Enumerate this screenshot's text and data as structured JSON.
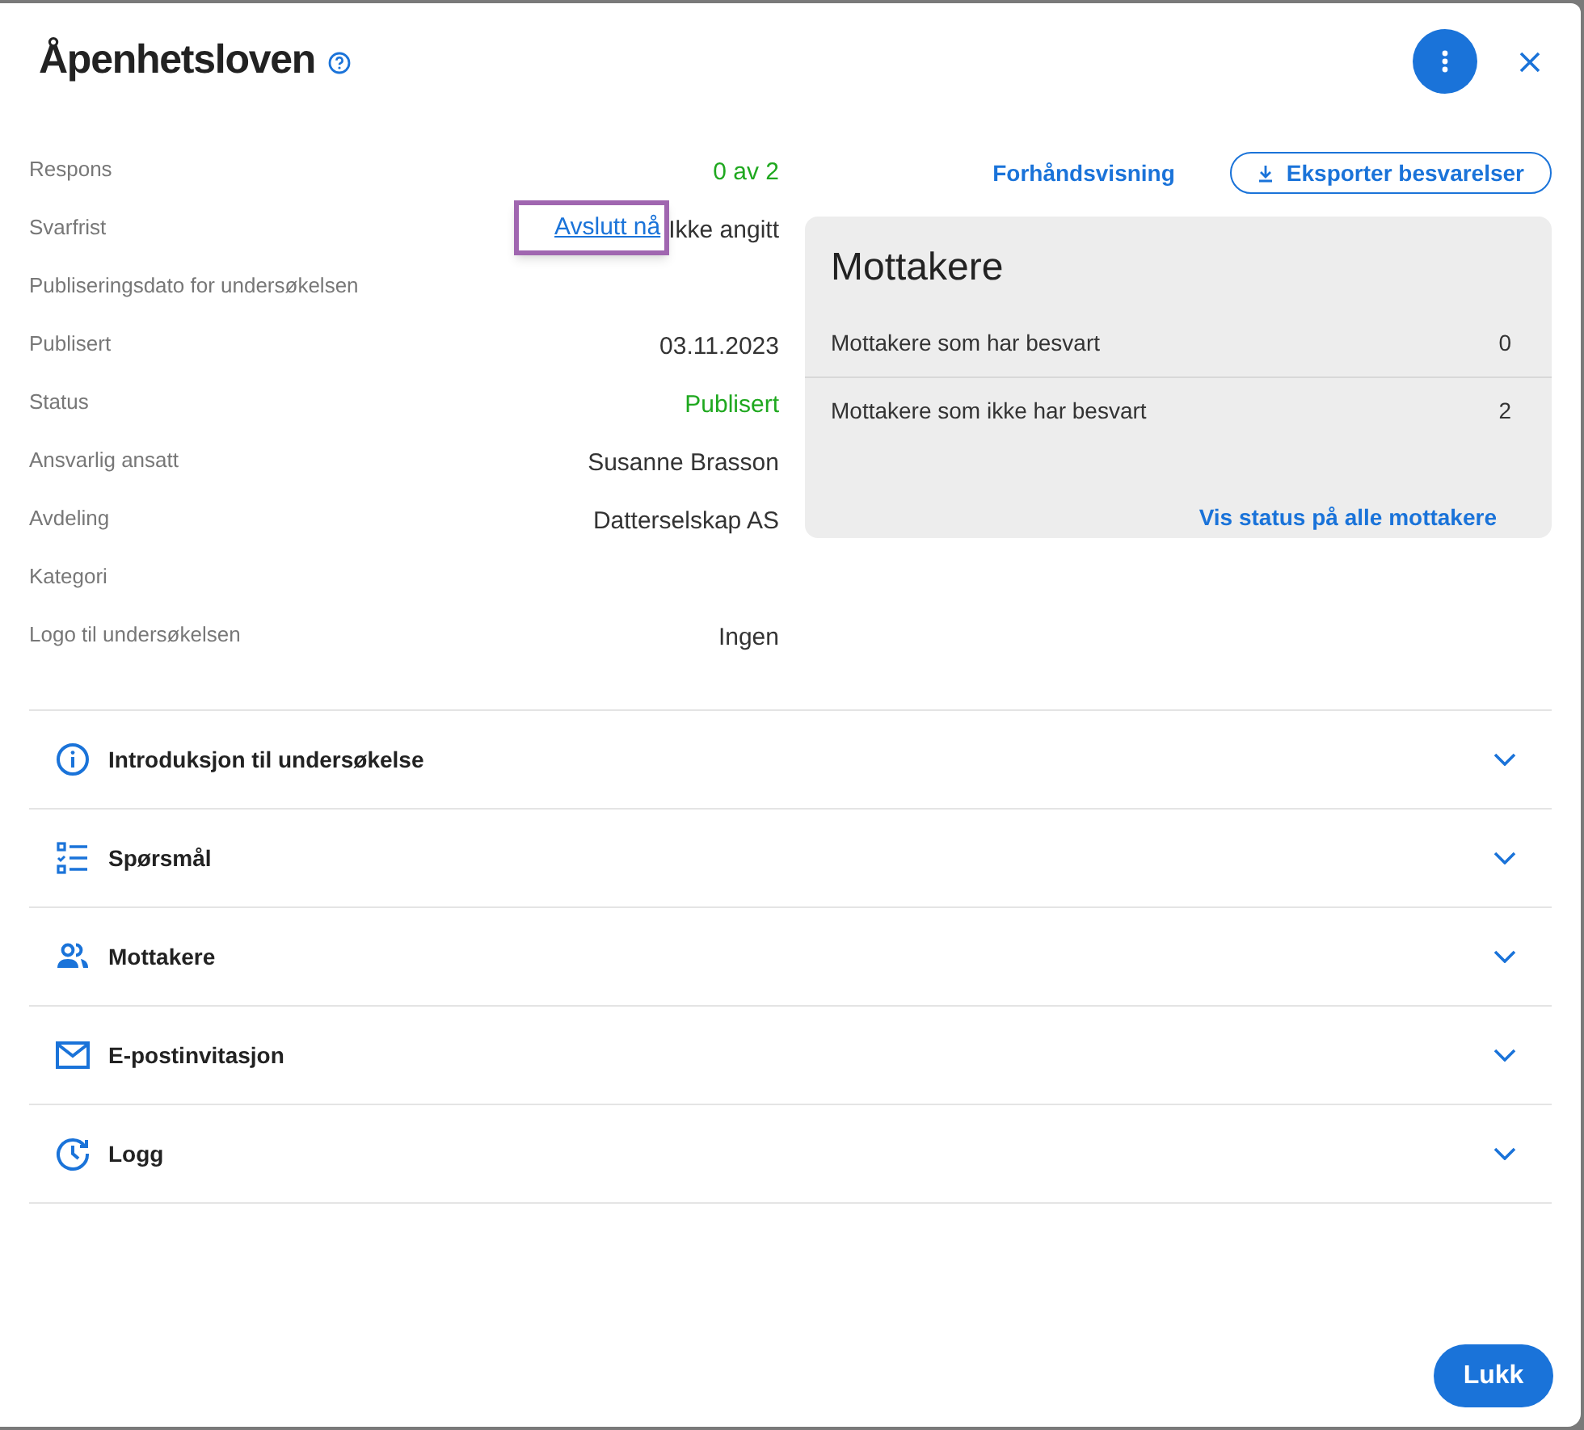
{
  "dialog": {
    "title": "Åpenhetsloven",
    "close_label": "Lukk"
  },
  "details": [
    {
      "label": "Respons",
      "value": "0 av 2",
      "color": "#1fa81f"
    },
    {
      "label": "Svarfrist",
      "value": "Ikke angitt",
      "color": "#333333",
      "link": "Avslutt nå",
      "highlighted": true
    },
    {
      "label": "Publiseringsdato for undersøkelsen"
    },
    {
      "label": "Publisert",
      "value": "03.11.2023",
      "color": "#333333"
    },
    {
      "label": "Status",
      "value": "Publisert",
      "color": "#1fa81f"
    },
    {
      "label": "Ansvarlig ansatt",
      "value": "Susanne Brasson",
      "color": "#333333"
    },
    {
      "label": "Avdeling",
      "value": "Datterselskap AS",
      "color": "#333333"
    },
    {
      "label": "Kategori"
    },
    {
      "label": "Logo til undersøkelsen",
      "value": "Ingen",
      "color": "#333333"
    }
  ],
  "actions": {
    "preview": "Forhåndsvisning",
    "export": "Eksporter besvarelser"
  },
  "recipients_card": {
    "title": "Mottakere",
    "rows": [
      {
        "label": "Mottakere som har besvart",
        "count": "0"
      },
      {
        "label": "Mottakere som ikke har besvart",
        "count": "2"
      }
    ],
    "link": "Vis status på alle mottakere"
  },
  "sections": [
    {
      "kind": "info",
      "label": "Introduksjon til undersøkelse",
      "expanded": false
    },
    {
      "kind": "checklist",
      "label": "Spørsmål",
      "expanded": false
    },
    {
      "kind": "people",
      "label": "Mottakere",
      "expanded": false
    },
    {
      "kind": "mail",
      "label": "E-postinvitasjon",
      "expanded": false
    },
    {
      "kind": "history",
      "label": "Logg",
      "expanded": false
    }
  ]
}
